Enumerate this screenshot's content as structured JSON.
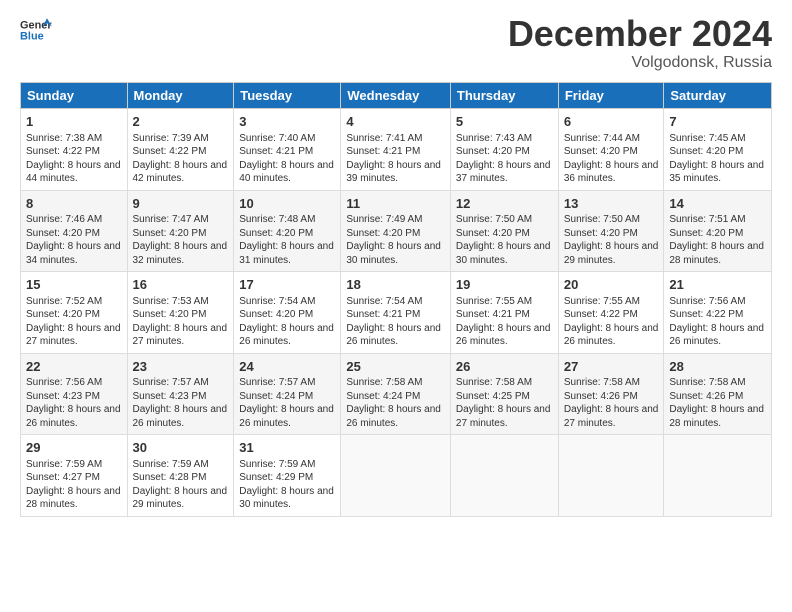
{
  "header": {
    "logo_line1": "General",
    "logo_line2": "Blue",
    "month": "December 2024",
    "location": "Volgodonsk, Russia"
  },
  "weekdays": [
    "Sunday",
    "Monday",
    "Tuesday",
    "Wednesday",
    "Thursday",
    "Friday",
    "Saturday"
  ],
  "weeks": [
    [
      {
        "day": "1",
        "sunrise": "Sunrise: 7:38 AM",
        "sunset": "Sunset: 4:22 PM",
        "daylight": "Daylight: 8 hours and 44 minutes."
      },
      {
        "day": "2",
        "sunrise": "Sunrise: 7:39 AM",
        "sunset": "Sunset: 4:22 PM",
        "daylight": "Daylight: 8 hours and 42 minutes."
      },
      {
        "day": "3",
        "sunrise": "Sunrise: 7:40 AM",
        "sunset": "Sunset: 4:21 PM",
        "daylight": "Daylight: 8 hours and 40 minutes."
      },
      {
        "day": "4",
        "sunrise": "Sunrise: 7:41 AM",
        "sunset": "Sunset: 4:21 PM",
        "daylight": "Daylight: 8 hours and 39 minutes."
      },
      {
        "day": "5",
        "sunrise": "Sunrise: 7:43 AM",
        "sunset": "Sunset: 4:20 PM",
        "daylight": "Daylight: 8 hours and 37 minutes."
      },
      {
        "day": "6",
        "sunrise": "Sunrise: 7:44 AM",
        "sunset": "Sunset: 4:20 PM",
        "daylight": "Daylight: 8 hours and 36 minutes."
      },
      {
        "day": "7",
        "sunrise": "Sunrise: 7:45 AM",
        "sunset": "Sunset: 4:20 PM",
        "daylight": "Daylight: 8 hours and 35 minutes."
      }
    ],
    [
      {
        "day": "8",
        "sunrise": "Sunrise: 7:46 AM",
        "sunset": "Sunset: 4:20 PM",
        "daylight": "Daylight: 8 hours and 34 minutes."
      },
      {
        "day": "9",
        "sunrise": "Sunrise: 7:47 AM",
        "sunset": "Sunset: 4:20 PM",
        "daylight": "Daylight: 8 hours and 32 minutes."
      },
      {
        "day": "10",
        "sunrise": "Sunrise: 7:48 AM",
        "sunset": "Sunset: 4:20 PM",
        "daylight": "Daylight: 8 hours and 31 minutes."
      },
      {
        "day": "11",
        "sunrise": "Sunrise: 7:49 AM",
        "sunset": "Sunset: 4:20 PM",
        "daylight": "Daylight: 8 hours and 30 minutes."
      },
      {
        "day": "12",
        "sunrise": "Sunrise: 7:50 AM",
        "sunset": "Sunset: 4:20 PM",
        "daylight": "Daylight: 8 hours and 30 minutes."
      },
      {
        "day": "13",
        "sunrise": "Sunrise: 7:50 AM",
        "sunset": "Sunset: 4:20 PM",
        "daylight": "Daylight: 8 hours and 29 minutes."
      },
      {
        "day": "14",
        "sunrise": "Sunrise: 7:51 AM",
        "sunset": "Sunset: 4:20 PM",
        "daylight": "Daylight: 8 hours and 28 minutes."
      }
    ],
    [
      {
        "day": "15",
        "sunrise": "Sunrise: 7:52 AM",
        "sunset": "Sunset: 4:20 PM",
        "daylight": "Daylight: 8 hours and 27 minutes."
      },
      {
        "day": "16",
        "sunrise": "Sunrise: 7:53 AM",
        "sunset": "Sunset: 4:20 PM",
        "daylight": "Daylight: 8 hours and 27 minutes."
      },
      {
        "day": "17",
        "sunrise": "Sunrise: 7:54 AM",
        "sunset": "Sunset: 4:20 PM",
        "daylight": "Daylight: 8 hours and 26 minutes."
      },
      {
        "day": "18",
        "sunrise": "Sunrise: 7:54 AM",
        "sunset": "Sunset: 4:21 PM",
        "daylight": "Daylight: 8 hours and 26 minutes."
      },
      {
        "day": "19",
        "sunrise": "Sunrise: 7:55 AM",
        "sunset": "Sunset: 4:21 PM",
        "daylight": "Daylight: 8 hours and 26 minutes."
      },
      {
        "day": "20",
        "sunrise": "Sunrise: 7:55 AM",
        "sunset": "Sunset: 4:22 PM",
        "daylight": "Daylight: 8 hours and 26 minutes."
      },
      {
        "day": "21",
        "sunrise": "Sunrise: 7:56 AM",
        "sunset": "Sunset: 4:22 PM",
        "daylight": "Daylight: 8 hours and 26 minutes."
      }
    ],
    [
      {
        "day": "22",
        "sunrise": "Sunrise: 7:56 AM",
        "sunset": "Sunset: 4:23 PM",
        "daylight": "Daylight: 8 hours and 26 minutes."
      },
      {
        "day": "23",
        "sunrise": "Sunrise: 7:57 AM",
        "sunset": "Sunset: 4:23 PM",
        "daylight": "Daylight: 8 hours and 26 minutes."
      },
      {
        "day": "24",
        "sunrise": "Sunrise: 7:57 AM",
        "sunset": "Sunset: 4:24 PM",
        "daylight": "Daylight: 8 hours and 26 minutes."
      },
      {
        "day": "25",
        "sunrise": "Sunrise: 7:58 AM",
        "sunset": "Sunset: 4:24 PM",
        "daylight": "Daylight: 8 hours and 26 minutes."
      },
      {
        "day": "26",
        "sunrise": "Sunrise: 7:58 AM",
        "sunset": "Sunset: 4:25 PM",
        "daylight": "Daylight: 8 hours and 27 minutes."
      },
      {
        "day": "27",
        "sunrise": "Sunrise: 7:58 AM",
        "sunset": "Sunset: 4:26 PM",
        "daylight": "Daylight: 8 hours and 27 minutes."
      },
      {
        "day": "28",
        "sunrise": "Sunrise: 7:58 AM",
        "sunset": "Sunset: 4:26 PM",
        "daylight": "Daylight: 8 hours and 28 minutes."
      }
    ],
    [
      {
        "day": "29",
        "sunrise": "Sunrise: 7:59 AM",
        "sunset": "Sunset: 4:27 PM",
        "daylight": "Daylight: 8 hours and 28 minutes."
      },
      {
        "day": "30",
        "sunrise": "Sunrise: 7:59 AM",
        "sunset": "Sunset: 4:28 PM",
        "daylight": "Daylight: 8 hours and 29 minutes."
      },
      {
        "day": "31",
        "sunrise": "Sunrise: 7:59 AM",
        "sunset": "Sunset: 4:29 PM",
        "daylight": "Daylight: 8 hours and 30 minutes."
      },
      null,
      null,
      null,
      null
    ]
  ]
}
